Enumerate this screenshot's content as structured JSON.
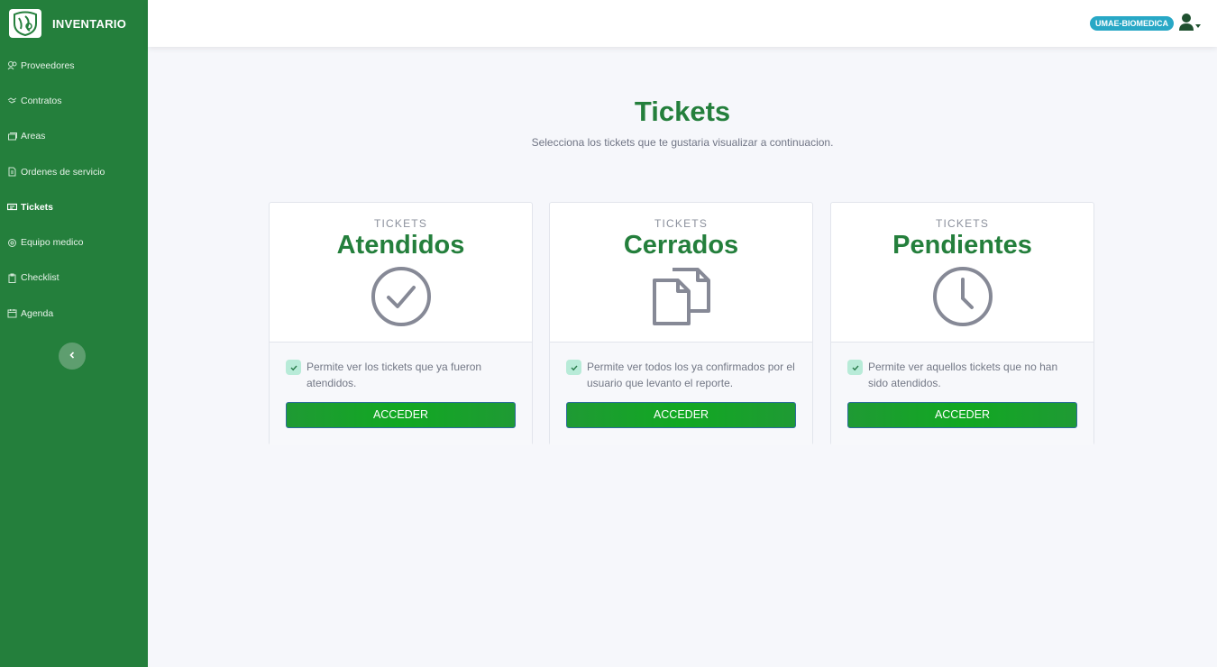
{
  "app": {
    "title": "INVENTARIO"
  },
  "sidebar": {
    "items": [
      {
        "label": "Proveedores",
        "icon": "users-icon"
      },
      {
        "label": "Contratos",
        "icon": "handshake-icon"
      },
      {
        "label": "Areas",
        "icon": "layers-icon"
      },
      {
        "label": "Ordenes de servicio",
        "icon": "document-icon"
      },
      {
        "label": "Tickets",
        "icon": "ticket-icon",
        "active": true
      },
      {
        "label": "Equipo medico",
        "icon": "gear-icon"
      },
      {
        "label": "Checklist",
        "icon": "clipboard-icon"
      },
      {
        "label": "Agenda",
        "icon": "calendar-icon"
      }
    ]
  },
  "topbar": {
    "badge": "UMAE-BIOMEDICA"
  },
  "main": {
    "title": "Tickets",
    "subtitle": "Selecciona los tickets que te gustaria visualizar a continuacion."
  },
  "cards": [
    {
      "kicker": "TICKETS",
      "title": "Atendidos",
      "icon": "check-circle-icon",
      "description": "Permite ver los tickets que ya fueron atendidos.",
      "button": "ACCEDER"
    },
    {
      "kicker": "TICKETS",
      "title": "Cerrados",
      "icon": "documents-icon",
      "description": "Permite ver todos los ya confirmados por el usuario que levanto el reporte.",
      "button": "ACCEDER"
    },
    {
      "kicker": "TICKETS",
      "title": "Pendientes",
      "icon": "clock-icon",
      "description": "Permite ver aquellos tickets que no han sido atendidos.",
      "button": "ACCEDER"
    }
  ],
  "colors": {
    "primary": "#247f3c",
    "badge": "#28a8c6",
    "button": "#11a822"
  }
}
